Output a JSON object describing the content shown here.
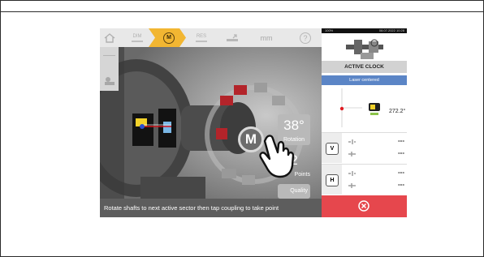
{
  "toolbar": {
    "home_icon": "home-icon",
    "dim": {
      "label": "DIM"
    },
    "measure": {
      "letter": "M",
      "active_color": "#f2b632"
    },
    "res": {
      "label": "RES"
    },
    "move_icon": "move-icon",
    "units": "mm",
    "help": "?"
  },
  "sidebar": {
    "icon": "machine-setup-icon"
  },
  "scene": {
    "angle": "38°",
    "angle_caption": "Rotation",
    "points": "2",
    "points_caption": "Points",
    "quality_caption": "Quality",
    "coupling_button": "M"
  },
  "status": {
    "message": "Rotate shafts to next active sector then tap coupling to take point"
  },
  "panel": {
    "phone_status_left": "100%",
    "phone_status_right": "08.07.2022 10:28",
    "title": "ACTIVE CLOCK",
    "laser_status": "Laser centered",
    "sensor_value": "272.2°",
    "rows": [
      {
        "badge": "V",
        "value_top": "---",
        "value_bottom": "---"
      },
      {
        "badge": "H",
        "value_top": "---",
        "value_bottom": "---"
      }
    ],
    "close_icon": "close-circle-icon"
  },
  "colors": {
    "accent": "#f2b632",
    "laser_blue": "#5b85c6",
    "close_red": "#e6474d",
    "sector_red": "#b3242a"
  }
}
